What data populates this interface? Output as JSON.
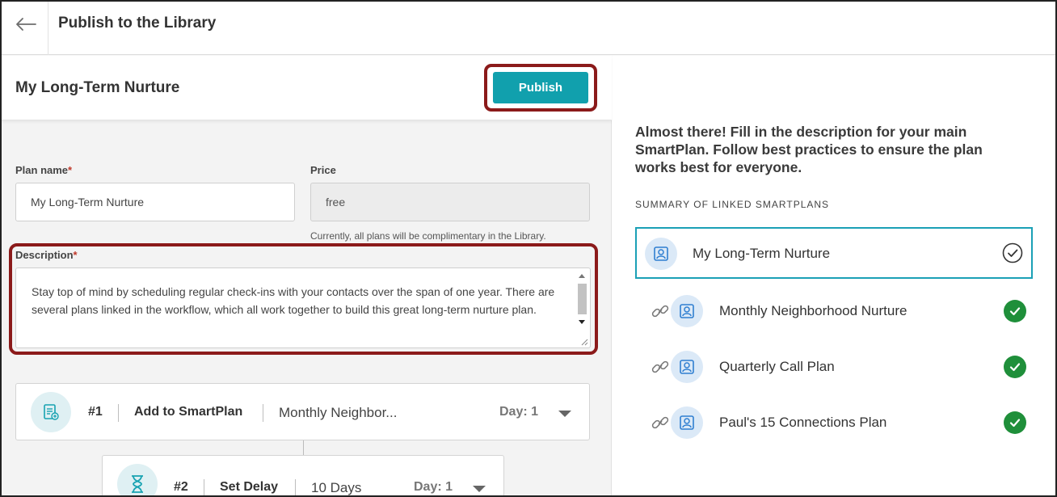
{
  "header": {
    "title": "Publish to the Library",
    "back_icon": "arrow-left-icon"
  },
  "plan": {
    "heading": "My Long-Term Nurture",
    "publish_label": "Publish",
    "plan_name_label": "Plan name",
    "required_mark": "*",
    "plan_name_value": "My Long-Term Nurture",
    "price_label": "Price",
    "price_value": "free",
    "price_hint": "Currently, all plans will be complimentary in the Library.",
    "description_label": "Description",
    "description_value": "Stay top of mind by scheduling regular check-ins with your contacts over the span of one year. There are several plans linked in the workflow, which all work together to build this great long-term nurture plan."
  },
  "steps": [
    {
      "number": "#1",
      "action": "Add to SmartPlan",
      "detail": "Monthly Neighbor...",
      "day": "Day: 1",
      "icon": "smartplan-icon"
    },
    {
      "number": "#2",
      "action": "Set Delay",
      "detail": "10 Days",
      "day": "Day: 1",
      "icon": "hourglass-icon"
    }
  ],
  "sidebar": {
    "intro": "Almost there! Fill in the description for your main SmartPlan. Follow best practices to ensure the plan works best for everyone.",
    "summary_title": "SUMMARY OF LINKED SMARTPLANS",
    "plans": [
      {
        "name": "My Long-Term Nurture",
        "linked": false,
        "status": "check-outline"
      },
      {
        "name": "Monthly Neighborhood Nurture",
        "linked": true,
        "status": "check-filled"
      },
      {
        "name": "Quarterly Call Plan",
        "linked": true,
        "status": "check-filled"
      },
      {
        "name": "Paul's 15 Connections Plan",
        "linked": true,
        "status": "check-filled"
      }
    ]
  },
  "colors": {
    "accent": "#11a0ad",
    "highlight": "#8b1a1a",
    "success": "#1f8f3a",
    "active_border": "#1ba0b6"
  }
}
